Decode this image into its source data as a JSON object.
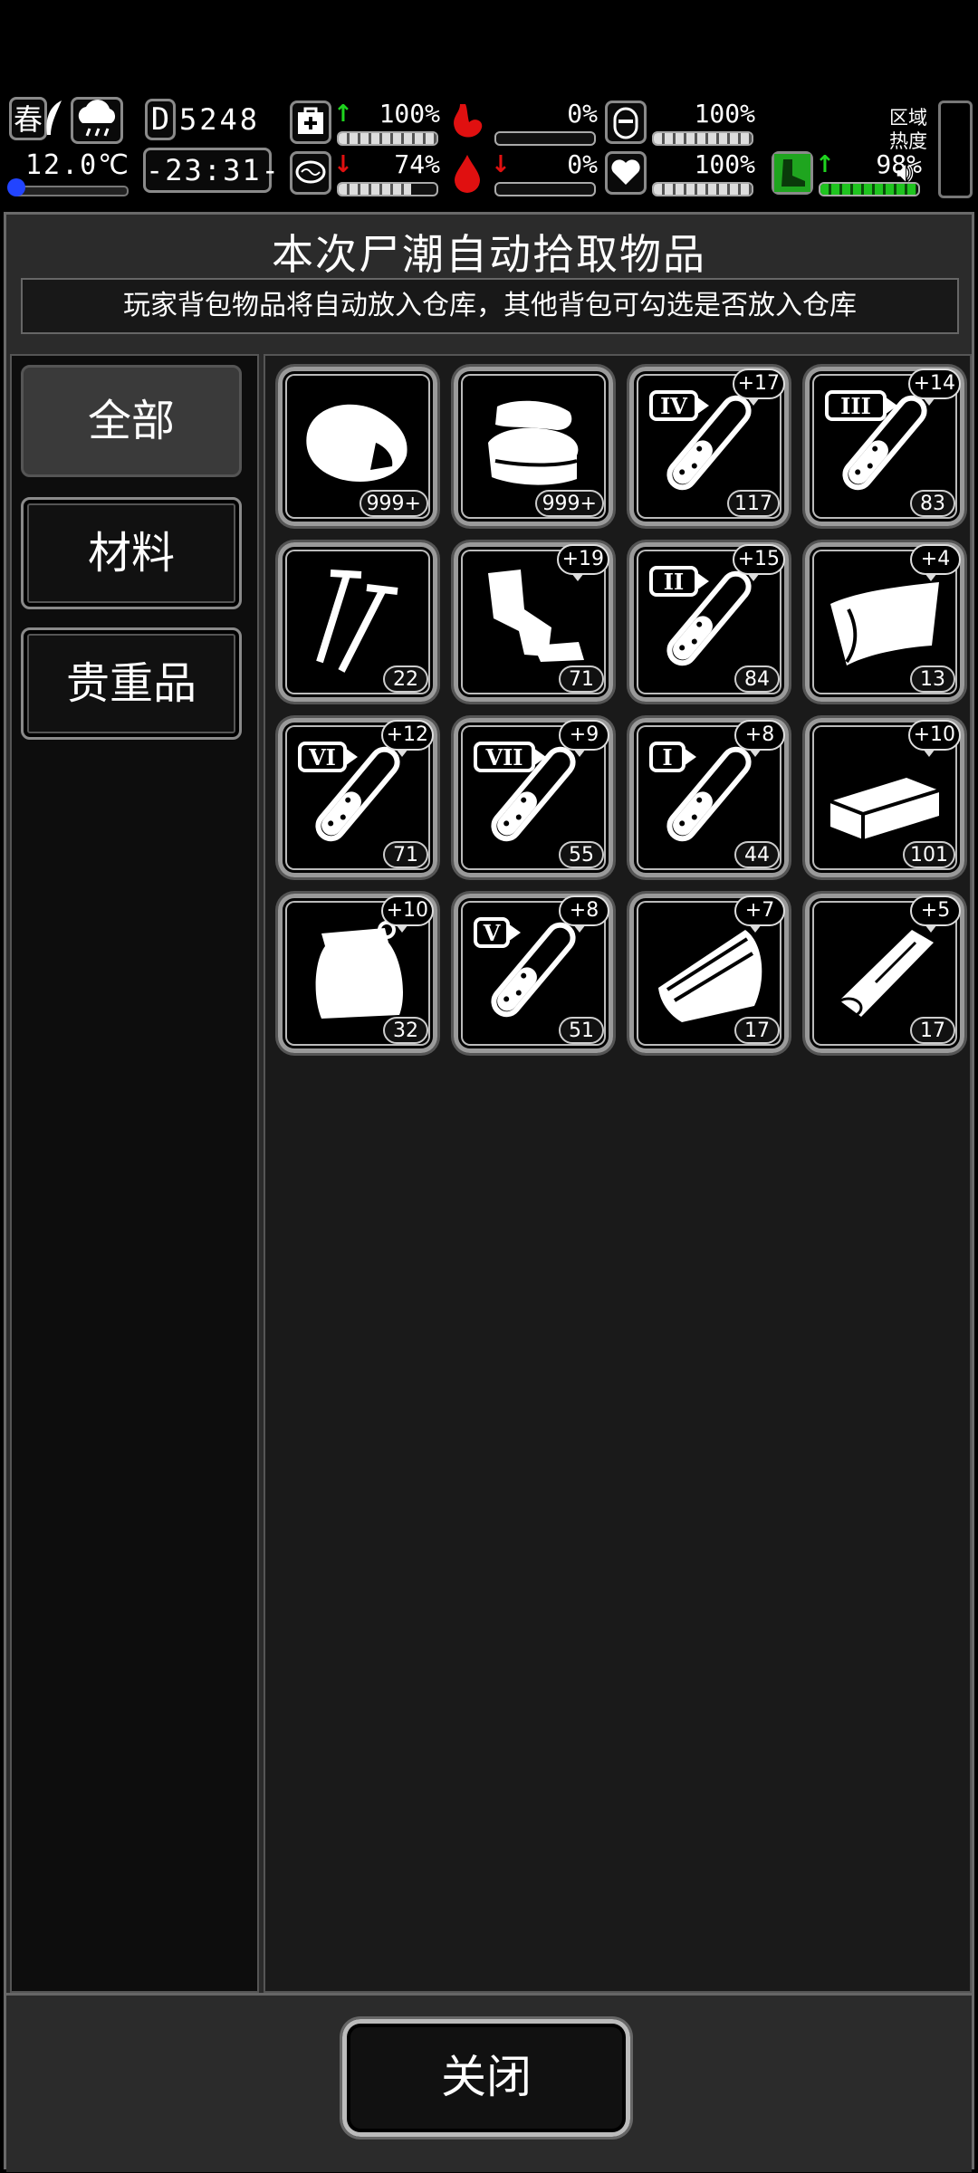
{
  "hud": {
    "season": "春",
    "temperature": "12.0℃",
    "day_prefix": "D",
    "day": "5248",
    "clock": "-23:31-",
    "stats": [
      {
        "name": "health",
        "arrow": "up",
        "percent": "100%",
        "value": 1.0
      },
      {
        "name": "stomach",
        "arrow": "",
        "percent": "0%",
        "value": 0.0
      },
      {
        "name": "shield",
        "arrow": "",
        "percent": "100%",
        "value": 1.0
      },
      {
        "name": "brain",
        "arrow": "down",
        "percent": "74%",
        "value": 0.74
      },
      {
        "name": "blood",
        "arrow": "down",
        "percent": "0%",
        "value": 0.0
      },
      {
        "name": "heart",
        "arrow": "",
        "percent": "100%",
        "value": 1.0
      },
      {
        "name": "stamina",
        "arrow": "up",
        "percent": "98%",
        "value": 0.98
      }
    ],
    "region_label_1": "区域",
    "region_label_2": "热度"
  },
  "dialog": {
    "title": "本次尸潮自动拾取物品",
    "subtitle": "玩家背包物品将自动放入仓库，其他背包可勾选是否放入仓库",
    "tabs": [
      {
        "label": "全部",
        "active": true
      },
      {
        "label": "材料",
        "active": false
      },
      {
        "label": "贵重品",
        "active": false
      }
    ],
    "close_label": "关闭"
  },
  "items": [
    {
      "icon": "meat-icon",
      "count": "999+",
      "bonus": ""
    },
    {
      "icon": "cloth-icon",
      "count": "999+",
      "bonus": ""
    },
    {
      "icon": "tube-iv-icon",
      "tier": "IV",
      "count": "117",
      "bonus": "+17"
    },
    {
      "icon": "tube-iii-icon",
      "tier": "III",
      "count": "83",
      "bonus": "+14"
    },
    {
      "icon": "nails-icon",
      "count": "22",
      "bonus": ""
    },
    {
      "icon": "scrap-metal-icon",
      "count": "71",
      "bonus": "+19"
    },
    {
      "icon": "tube-ii-icon",
      "tier": "II",
      "count": "84",
      "bonus": "+15"
    },
    {
      "icon": "fabric-icon",
      "count": "13",
      "bonus": "+4"
    },
    {
      "icon": "tube-vi-icon",
      "tier": "VI",
      "count": "71",
      "bonus": "+12"
    },
    {
      "icon": "tube-vii-icon",
      "tier": "VII",
      "count": "55",
      "bonus": "+9"
    },
    {
      "icon": "tube-i-icon",
      "tier": "I",
      "count": "44",
      "bonus": "+8"
    },
    {
      "icon": "brick-icon",
      "count": "101",
      "bonus": "+10"
    },
    {
      "icon": "bag-icon",
      "count": "32",
      "bonus": "+10"
    },
    {
      "icon": "tube-v-icon",
      "tier": "V",
      "count": "51",
      "bonus": "+8"
    },
    {
      "icon": "wood-plank-icon",
      "count": "17",
      "bonus": "+7"
    },
    {
      "icon": "log-icon",
      "count": "17",
      "bonus": "+5"
    }
  ]
}
